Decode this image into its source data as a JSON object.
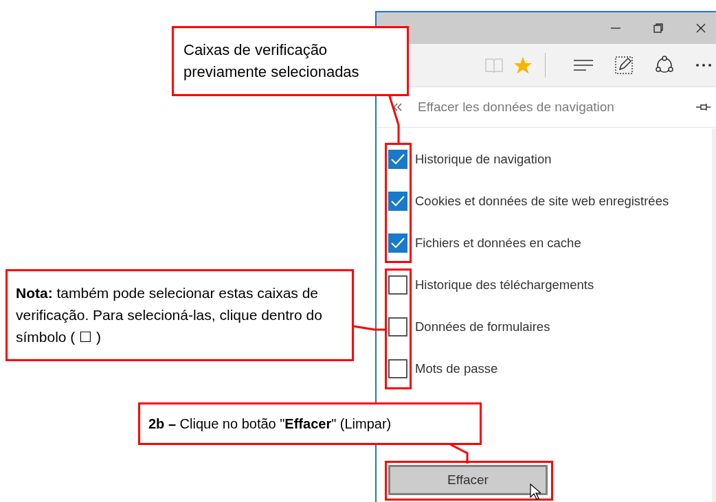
{
  "window": {
    "panel": {
      "title": "Effacer les données de navigation",
      "items": [
        {
          "label": "Historique de navigation",
          "checked": true
        },
        {
          "label": "Cookies et données de site web enregistrées",
          "checked": true
        },
        {
          "label": "Fichiers et données en cache",
          "checked": true
        },
        {
          "label": "Historique des téléchargements",
          "checked": false
        },
        {
          "label": "Données de formulaires",
          "checked": false
        },
        {
          "label": "Mots de passe",
          "checked": false
        }
      ],
      "button": "Effacer"
    }
  },
  "annotations": [
    {
      "kind": "top",
      "text": "Caixas de verificação previamente selecionadas"
    },
    {
      "kind": "middle",
      "text": "**Nota:** também pode selecionar estas caixas de verificação. Para selecioná-las, clique dentro do símbolo ( ☐ )"
    },
    {
      "kind": "bottom",
      "text": "**2b –** Clique no botão \"**Effacer**\" (Limpar)"
    }
  ]
}
